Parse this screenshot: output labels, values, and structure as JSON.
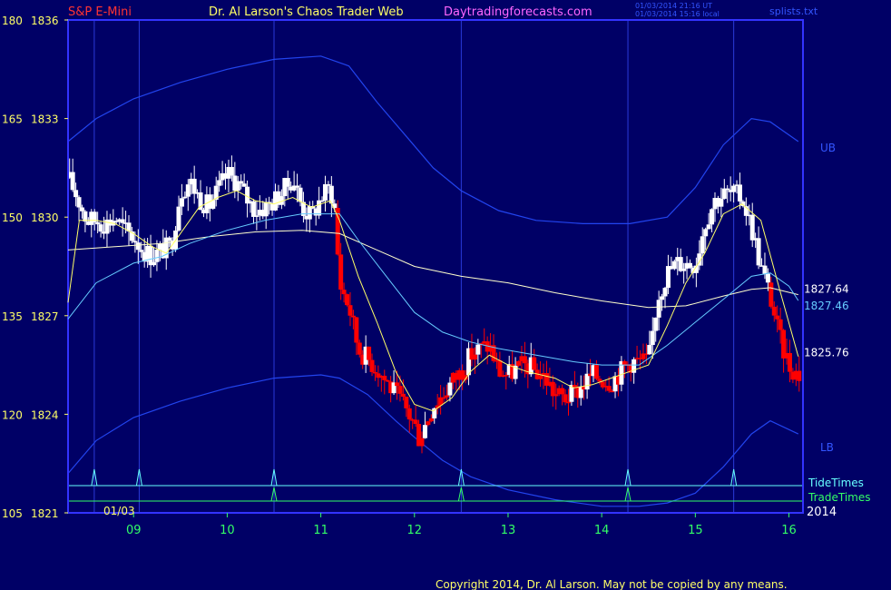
{
  "header": {
    "symbol": "S&P E-Mini",
    "title": "Dr. Al Larson's Chaos Trader Web",
    "site": "Daytradingforecasts.com",
    "timestamp_utc": "01/03/2014 21:16 UT",
    "timestamp_local": "01/03/2014 15:16 local",
    "file": "splists.txt"
  },
  "footer": {
    "copyright": "Copyright 2014, Dr. Al Larson. May not be copied by any means."
  },
  "date_label": "01/03",
  "year_label": "2014",
  "colors": {
    "background": "#000066",
    "frame": "#3333ff",
    "axis_text": "#ffff66",
    "up_bar": "#ffffff",
    "down_bar": "#ff0000",
    "ema_fast": "#ffff66",
    "ema_mid": "#66ccff",
    "ema_slow": "#ffffcc",
    "bands": "#2244ee",
    "tide": "#66ffff",
    "trade": "#33ff66",
    "symbol": "#ff3333",
    "site": "#ff66ff"
  },
  "chart_data": {
    "type": "candlestick",
    "y_left_ticks": [
      {
        "osc": "180",
        "price": "1836",
        "v": 1836
      },
      {
        "osc": "165",
        "price": "1833",
        "v": 1833
      },
      {
        "osc": "150",
        "price": "1830",
        "v": 1830
      },
      {
        "osc": "135",
        "price": "1827",
        "v": 1827
      },
      {
        "osc": "120",
        "price": "1824",
        "v": 1824
      },
      {
        "osc": "105",
        "price": "1821",
        "v": 1821
      }
    ],
    "x_ticks": [
      "09",
      "10",
      "11",
      "12",
      "13",
      "14",
      "15",
      "16"
    ],
    "x_tick_hours": [
      9,
      10,
      11,
      12,
      13,
      14,
      15,
      16
    ],
    "x_range": [
      8.3,
      16.15
    ],
    "y_range": [
      1821,
      1836
    ],
    "vertical_time_lines": [
      8.58,
      9.06,
      10.5,
      12.5,
      14.28,
      15.41
    ],
    "tide_times": [
      8.58,
      9.06,
      10.5,
      12.5,
      14.28,
      15.41
    ],
    "trade_times": [
      10.5,
      12.5,
      14.28
    ],
    "tide_label": "TideTimes",
    "trade_label": "TradeTimes",
    "band_labels": {
      "upper": "UB",
      "lower": "LB"
    },
    "value_labels": [
      {
        "text": "1827.64",
        "v": 1827.64,
        "color": "#ffffff"
      },
      {
        "text": "1827.46",
        "v": 1827.46,
        "color": "#66ccff"
      },
      {
        "text": "1825.76",
        "v": 1825.76,
        "color": "#ffffff"
      }
    ],
    "price_path": [
      [
        8.3,
        1831.2
      ],
      [
        8.4,
        1830.6
      ],
      [
        8.5,
        1829.9
      ],
      [
        8.6,
        1829.9
      ],
      [
        8.7,
        1829.8
      ],
      [
        8.8,
        1830.0
      ],
      [
        8.9,
        1829.6
      ],
      [
        9.0,
        1829.4
      ],
      [
        9.1,
        1829.0
      ],
      [
        9.2,
        1828.8
      ],
      [
        9.3,
        1829.0
      ],
      [
        9.4,
        1829.1
      ],
      [
        9.5,
        1830.8
      ],
      [
        9.6,
        1831.1
      ],
      [
        9.7,
        1830.6
      ],
      [
        9.8,
        1830.3
      ],
      [
        9.9,
        1830.8
      ],
      [
        10.0,
        1831.3
      ],
      [
        10.1,
        1831.1
      ],
      [
        10.2,
        1830.6
      ],
      [
        10.3,
        1830.2
      ],
      [
        10.4,
        1830.3
      ],
      [
        10.5,
        1830.5
      ],
      [
        10.6,
        1830.8
      ],
      [
        10.7,
        1831.2
      ],
      [
        10.8,
        1830.3
      ],
      [
        10.9,
        1830.0
      ],
      [
        11.0,
        1830.6
      ],
      [
        11.1,
        1830.9
      ],
      [
        11.15,
        1830.2
      ],
      [
        11.2,
        1828.0
      ],
      [
        11.3,
        1827.3
      ],
      [
        11.4,
        1826.0
      ],
      [
        11.5,
        1825.7
      ],
      [
        11.6,
        1825.4
      ],
      [
        11.7,
        1825.0
      ],
      [
        11.8,
        1824.6
      ],
      [
        11.9,
        1824.2
      ],
      [
        12.0,
        1823.7
      ],
      [
        12.05,
        1823.3
      ],
      [
        12.1,
        1823.6
      ],
      [
        12.2,
        1824.3
      ],
      [
        12.3,
        1824.6
      ],
      [
        12.4,
        1825.0
      ],
      [
        12.5,
        1825.3
      ],
      [
        12.6,
        1825.8
      ],
      [
        12.7,
        1826.0
      ],
      [
        12.8,
        1826.1
      ],
      [
        12.9,
        1825.3
      ],
      [
        13.0,
        1825.2
      ],
      [
        13.1,
        1825.4
      ],
      [
        13.2,
        1825.5
      ],
      [
        13.3,
        1825.3
      ],
      [
        13.4,
        1825.1
      ],
      [
        13.5,
        1824.6
      ],
      [
        13.6,
        1824.5
      ],
      [
        13.7,
        1824.6
      ],
      [
        13.8,
        1824.9
      ],
      [
        13.9,
        1825.2
      ],
      [
        14.0,
        1825.1
      ],
      [
        14.1,
        1825.0
      ],
      [
        14.2,
        1825.3
      ],
      [
        14.3,
        1825.6
      ],
      [
        14.4,
        1825.6
      ],
      [
        14.5,
        1825.6
      ],
      [
        14.6,
        1827.6
      ],
      [
        14.7,
        1828.3
      ],
      [
        14.8,
        1828.6
      ],
      [
        14.9,
        1828.6
      ],
      [
        15.0,
        1828.6
      ],
      [
        15.1,
        1829.8
      ],
      [
        15.2,
        1830.5
      ],
      [
        15.3,
        1830.7
      ],
      [
        15.4,
        1830.7
      ],
      [
        15.5,
        1830.6
      ],
      [
        15.6,
        1829.7
      ],
      [
        15.7,
        1828.5
      ],
      [
        15.8,
        1827.6
      ],
      [
        15.9,
        1826.3
      ],
      [
        16.0,
        1825.5
      ],
      [
        16.1,
        1825.2
      ]
    ],
    "ema_fast": [
      [
        8.3,
        1827.4
      ],
      [
        8.42,
        1829.9
      ],
      [
        8.6,
        1829.9
      ],
      [
        8.8,
        1829.8
      ],
      [
        9.0,
        1829.5
      ],
      [
        9.2,
        1829.1
      ],
      [
        9.35,
        1828.9
      ],
      [
        9.5,
        1829.5
      ],
      [
        9.7,
        1830.3
      ],
      [
        9.9,
        1830.6
      ],
      [
        10.1,
        1830.8
      ],
      [
        10.3,
        1830.5
      ],
      [
        10.5,
        1830.4
      ],
      [
        10.7,
        1830.6
      ],
      [
        10.9,
        1830.3
      ],
      [
        11.1,
        1830.5
      ],
      [
        11.2,
        1829.9
      ],
      [
        11.4,
        1828.2
      ],
      [
        11.6,
        1826.8
      ],
      [
        11.8,
        1825.3
      ],
      [
        12.0,
        1824.3
      ],
      [
        12.2,
        1824.1
      ],
      [
        12.4,
        1824.5
      ],
      [
        12.6,
        1825.3
      ],
      [
        12.8,
        1825.8
      ],
      [
        13.0,
        1825.5
      ],
      [
        13.2,
        1825.3
      ],
      [
        13.5,
        1825.1
      ],
      [
        13.7,
        1824.8
      ],
      [
        13.9,
        1824.9
      ],
      [
        14.1,
        1825.1
      ],
      [
        14.3,
        1825.3
      ],
      [
        14.5,
        1825.5
      ],
      [
        14.7,
        1826.7
      ],
      [
        14.9,
        1828.0
      ],
      [
        15.1,
        1828.9
      ],
      [
        15.3,
        1830.1
      ],
      [
        15.5,
        1830.4
      ],
      [
        15.7,
        1829.9
      ],
      [
        15.9,
        1827.8
      ],
      [
        16.1,
        1825.76
      ]
    ],
    "ema_mid": [
      [
        8.3,
        1826.9
      ],
      [
        8.6,
        1828.0
      ],
      [
        9.0,
        1828.6
      ],
      [
        9.3,
        1828.8
      ],
      [
        9.6,
        1829.2
      ],
      [
        10.0,
        1829.6
      ],
      [
        10.4,
        1829.9
      ],
      [
        10.8,
        1830.1
      ],
      [
        11.2,
        1830.1
      ],
      [
        11.4,
        1829.3
      ],
      [
        11.7,
        1828.2
      ],
      [
        12.0,
        1827.1
      ],
      [
        12.3,
        1826.5
      ],
      [
        12.6,
        1826.2
      ],
      [
        12.9,
        1826.0
      ],
      [
        13.3,
        1825.8
      ],
      [
        13.7,
        1825.6
      ],
      [
        14.0,
        1825.5
      ],
      [
        14.4,
        1825.5
      ],
      [
        14.7,
        1826.1
      ],
      [
        15.0,
        1826.8
      ],
      [
        15.3,
        1827.5
      ],
      [
        15.6,
        1828.2
      ],
      [
        15.8,
        1828.3
      ],
      [
        16.0,
        1827.9
      ],
      [
        16.1,
        1827.46
      ]
    ],
    "ema_slow": [
      [
        8.3,
        1829.0
      ],
      [
        8.8,
        1829.1
      ],
      [
        9.3,
        1829.2
      ],
      [
        9.8,
        1829.4
      ],
      [
        10.3,
        1829.55
      ],
      [
        10.8,
        1829.6
      ],
      [
        11.2,
        1829.5
      ],
      [
        11.6,
        1829.0
      ],
      [
        12.0,
        1828.5
      ],
      [
        12.5,
        1828.2
      ],
      [
        13.0,
        1828.0
      ],
      [
        13.5,
        1827.7
      ],
      [
        14.0,
        1827.45
      ],
      [
        14.5,
        1827.25
      ],
      [
        14.9,
        1827.3
      ],
      [
        15.3,
        1827.6
      ],
      [
        15.6,
        1827.8
      ],
      [
        15.8,
        1827.85
      ],
      [
        16.1,
        1827.64
      ]
    ],
    "upper_band": [
      [
        8.3,
        1832.3
      ],
      [
        8.6,
        1833.0
      ],
      [
        9.0,
        1833.6
      ],
      [
        9.5,
        1834.1
      ],
      [
        10.0,
        1834.5
      ],
      [
        10.5,
        1834.8
      ],
      [
        11.0,
        1834.9
      ],
      [
        11.3,
        1834.6
      ],
      [
        11.6,
        1833.5
      ],
      [
        11.9,
        1832.5
      ],
      [
        12.2,
        1831.5
      ],
      [
        12.5,
        1830.8
      ],
      [
        12.9,
        1830.2
      ],
      [
        13.3,
        1829.9
      ],
      [
        13.8,
        1829.8
      ],
      [
        14.3,
        1829.8
      ],
      [
        14.7,
        1830.0
      ],
      [
        15.0,
        1830.9
      ],
      [
        15.3,
        1832.2
      ],
      [
        15.6,
        1833.0
      ],
      [
        15.8,
        1832.9
      ],
      [
        16.1,
        1832.3
      ]
    ],
    "lower_band": [
      [
        8.3,
        1822.2
      ],
      [
        8.6,
        1823.2
      ],
      [
        9.0,
        1823.9
      ],
      [
        9.5,
        1824.4
      ],
      [
        10.0,
        1824.8
      ],
      [
        10.5,
        1825.1
      ],
      [
        11.0,
        1825.2
      ],
      [
        11.2,
        1825.1
      ],
      [
        11.5,
        1824.6
      ],
      [
        11.8,
        1823.8
      ],
      [
        12.0,
        1823.3
      ],
      [
        12.3,
        1822.6
      ],
      [
        12.6,
        1822.1
      ],
      [
        13.0,
        1821.7
      ],
      [
        13.5,
        1821.4
      ],
      [
        14.0,
        1821.2
      ],
      [
        14.4,
        1821.2
      ],
      [
        14.7,
        1821.3
      ],
      [
        15.0,
        1821.6
      ],
      [
        15.3,
        1822.4
      ],
      [
        15.6,
        1823.4
      ],
      [
        15.8,
        1823.8
      ],
      [
        16.1,
        1823.4
      ]
    ]
  }
}
